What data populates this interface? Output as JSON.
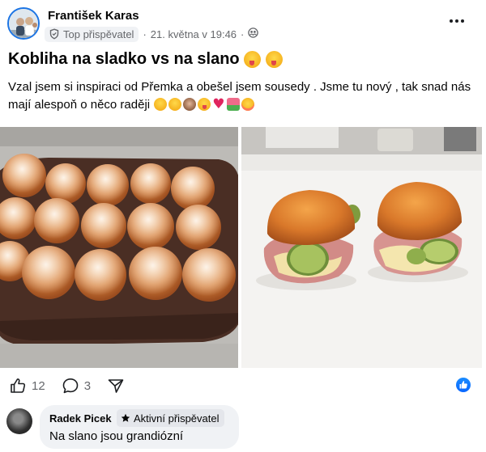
{
  "post": {
    "author": "František Karas",
    "badge": "Top přispěvatel",
    "separator": "·",
    "date": "21. května v 19:46",
    "separator2": "·",
    "audience_icon": "friends-globe-icon",
    "title": "Kobliha na sladko vs na slano",
    "title_emojis": [
      "squinting-tongue-emoji",
      "squinting-tongue-emoji"
    ],
    "body": "Vzal jsem si inspiraci od Přemka a obešel jsem sousedy . Jsme tu nový , tak snad nás mají alespoň o něco raději",
    "body_emojis": [
      "grinning-emoji",
      "smiling-halo-emoji",
      "see-no-evil-monkey-emoji",
      "tongue-emoji",
      "red-heart-emoji",
      "tulip-emoji",
      "partying-face-emoji"
    ]
  },
  "photos": [
    {
      "name": "sweet-donuts-photo"
    },
    {
      "name": "savory-donut-sandwiches-photo"
    }
  ],
  "actions": {
    "like_count": "12",
    "comment_count": "3",
    "like_icon": "thumbs-up-icon",
    "comment_icon": "comment-bubble-icon",
    "share_icon": "share-icon",
    "reaction_icon": "like-reaction-icon"
  },
  "comment": {
    "author": "Radek Picek",
    "badge": "Aktivní přispěvatel",
    "text": "Na slano jsou grandiózní"
  },
  "colors": {
    "accent": "#0866ff",
    "secondary_text": "#65676b",
    "bubble": "#f0f2f5"
  }
}
